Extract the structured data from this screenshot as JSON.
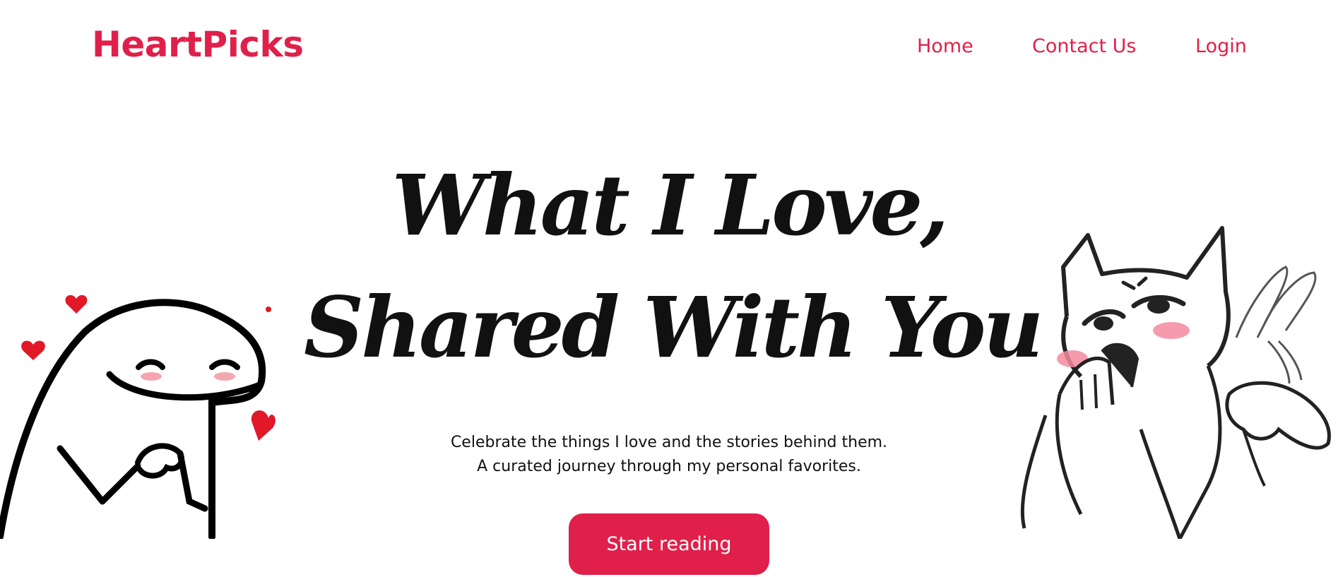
{
  "header": {
    "logo_text": "HeartPicks",
    "nav": {
      "home": "Home",
      "contact": "Contact Us",
      "login": "Login"
    }
  },
  "hero": {
    "headline_line1": "What I Love,",
    "headline_line2": "Shared With You",
    "subtitle_line1": "Celebrate the things I love and the stories behind them.",
    "subtitle_line2": "A curated journey through my personal favorites.",
    "cta_label": "Start reading"
  },
  "illustrations": {
    "left": "blushing-blob-character-with-hearts",
    "right": "blushing-cat-character-waving"
  },
  "colors": {
    "accent": "#e0204a",
    "text": "#111111",
    "background": "#ffffff"
  }
}
